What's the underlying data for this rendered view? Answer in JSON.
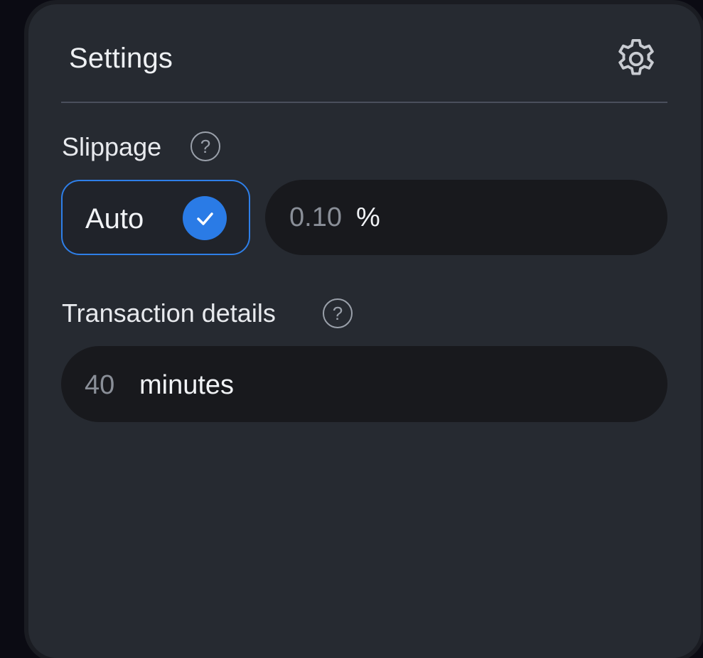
{
  "header": {
    "title": "Settings",
    "settings_icon": "gear-icon"
  },
  "slippage": {
    "label": "Slippage",
    "help_icon": "?",
    "auto_label": "Auto",
    "auto_selected": true,
    "value": "0.10",
    "unit": "%"
  },
  "transaction": {
    "label": "Transaction details",
    "help_icon": "?",
    "value": "40",
    "unit": "minutes"
  },
  "colors": {
    "accent": "#2a7be6",
    "panel": "#262a31",
    "input": "#18191d"
  }
}
